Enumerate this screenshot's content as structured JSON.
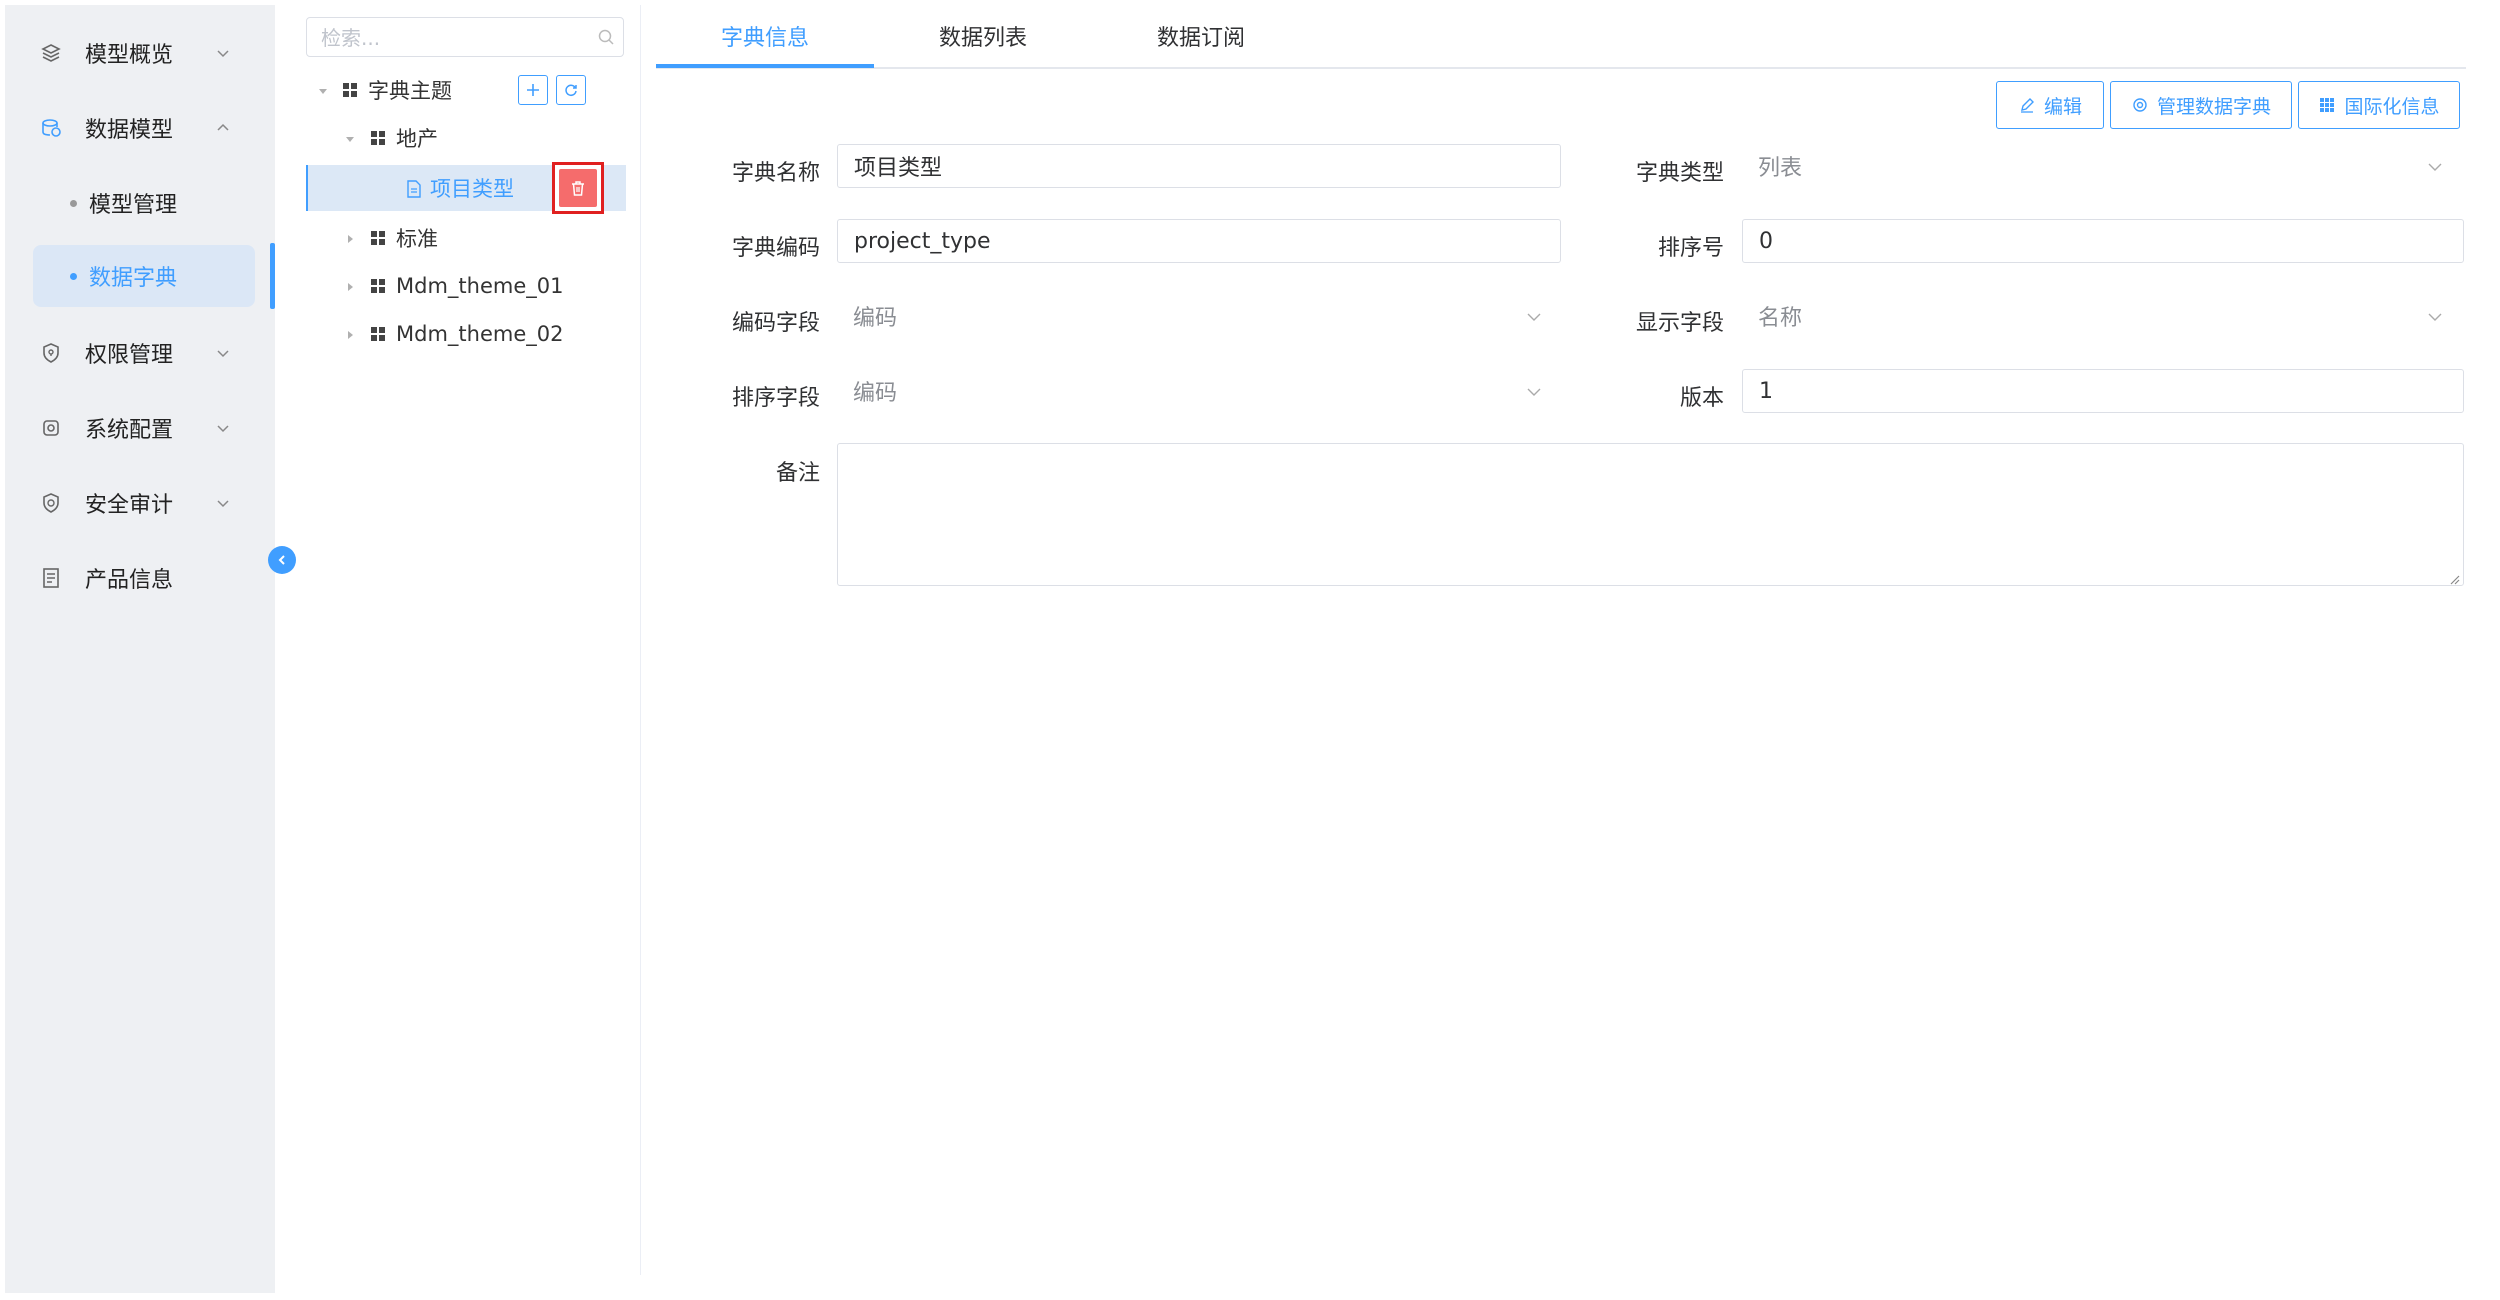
{
  "sidebar": {
    "items": [
      {
        "label": "模型概览",
        "icon": "layers-icon"
      },
      {
        "label": "数据模型",
        "icon": "database-icon"
      },
      {
        "label": "权限管理",
        "icon": "shield-icon"
      },
      {
        "label": "系统配置",
        "icon": "settings-icon"
      },
      {
        "label": "安全审计",
        "icon": "audit-shield-icon"
      },
      {
        "label": "产品信息",
        "icon": "document-icon"
      }
    ],
    "subitems": [
      {
        "label": "模型管理"
      },
      {
        "label": "数据字典"
      }
    ]
  },
  "tree": {
    "search_placeholder": "检索...",
    "nodes": [
      {
        "label": "字典主题"
      },
      {
        "label": "地产"
      },
      {
        "label": "项目类型"
      },
      {
        "label": "标准"
      },
      {
        "label": "Mdm_theme_01"
      },
      {
        "label": "Mdm_theme_02"
      }
    ]
  },
  "tabs": [
    {
      "label": "字典信息"
    },
    {
      "label": "数据列表"
    },
    {
      "label": "数据订阅"
    }
  ],
  "actions": {
    "edit": "编辑",
    "manage": "管理数据字典",
    "i18n": "国际化信息"
  },
  "form": {
    "dict_name_label": "字典名称",
    "dict_name_value": "项目类型",
    "dict_type_label": "字典类型",
    "dict_type_value": "列表",
    "dict_code_label": "字典编码",
    "dict_code_value": "project_type",
    "sort_no_label": "排序号",
    "sort_no_value": "0",
    "code_field_label": "编码字段",
    "code_field_value": "编码",
    "display_field_label": "显示字段",
    "display_field_value": "名称",
    "sort_field_label": "排序字段",
    "sort_field_value": "编码",
    "version_label": "版本",
    "version_value": "1",
    "remark_label": "备注"
  },
  "colors": {
    "accent": "#409eff",
    "danger": "#f56c6c",
    "highlight_border": "#e02020"
  }
}
